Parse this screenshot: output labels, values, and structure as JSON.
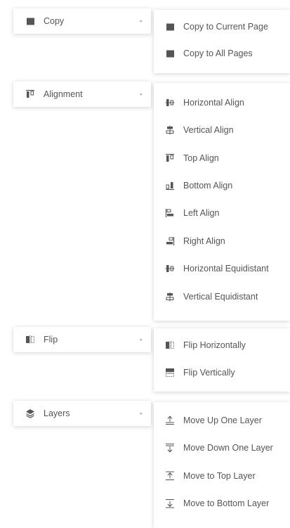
{
  "copy": {
    "label": "Copy",
    "submenu": [
      "Copy to Current Page",
      "Copy to All Pages"
    ]
  },
  "alignment": {
    "label": "Alignment",
    "submenu": [
      "Horizontal Align",
      "Vertical Align",
      "Top Align",
      "Bottom Align",
      "Left Align",
      "Right Align",
      "Horizontal Equidistant",
      "Vertical Equidistant"
    ]
  },
  "flip": {
    "label": "Flip",
    "submenu": [
      "Flip Horizontally",
      "Flip Vertically"
    ]
  },
  "layers": {
    "label": "Layers",
    "submenu": [
      "Move Up One Layer",
      "Move Down One Layer",
      "Move to Top Layer",
      "Move to Bottom Layer"
    ]
  },
  "submenu_arrow": "▸",
  "colors": {
    "icon": "#555555",
    "text": "#555555",
    "arrow": "#aaaaaa",
    "panel": "#ffffff"
  }
}
